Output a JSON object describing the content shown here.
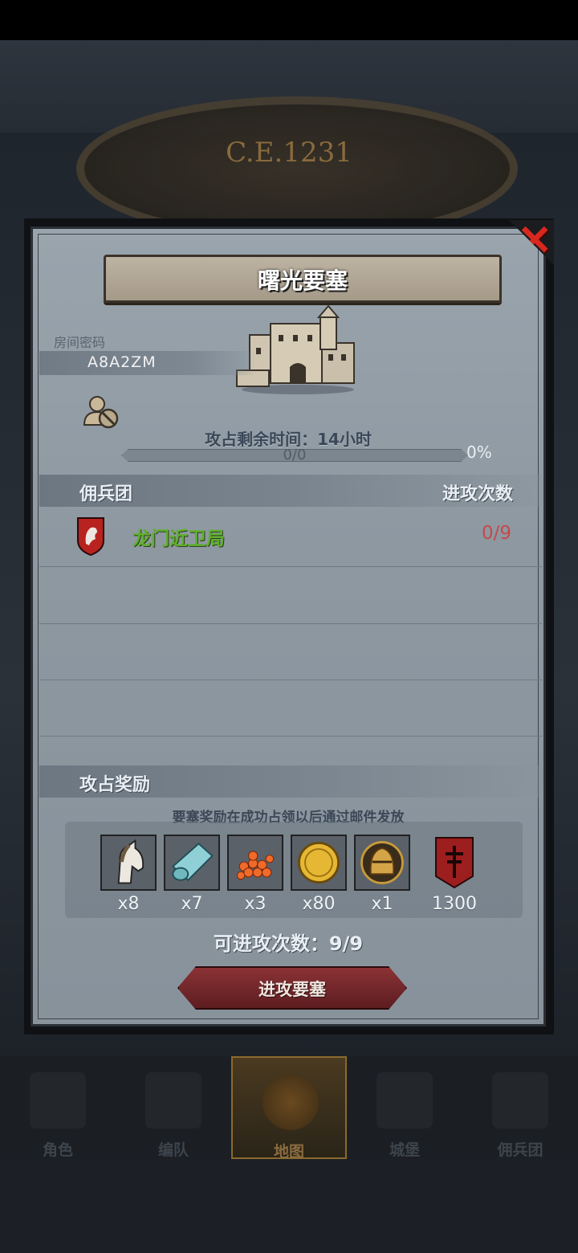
{
  "background": {
    "era_text": "C.E.1231"
  },
  "modal": {
    "title": "曙光要塞",
    "room_code_label": "房间密码",
    "room_code": "A8A2ZM",
    "time_remaining": "攻占剩余时间：14小时",
    "progress": {
      "value_text": "0/0",
      "percent_text": "0%",
      "fraction": 0
    },
    "mercenary_section": {
      "title": "佣兵团",
      "right_header": "进攻次数",
      "rows": [
        {
          "name": "龙门近卫局",
          "attacks": "0/9",
          "shield_color": "#b8231f"
        }
      ]
    },
    "reward_section": {
      "title": "攻占奖励",
      "notice": "要塞奖励在成功占领以后通过邮件发放",
      "items": [
        {
          "icon": "horse-icon",
          "qty": "x8"
        },
        {
          "icon": "cloth-roll-icon",
          "qty": "x7"
        },
        {
          "icon": "caviar-icon",
          "qty": "x3"
        },
        {
          "icon": "gold-coin-icon",
          "qty": "x80"
        },
        {
          "icon": "knight-helmet-icon",
          "qty": "x1"
        },
        {
          "icon": "guild-banner-icon",
          "qty": "1300"
        }
      ]
    },
    "attempts_text": "可进攻次数：9/9",
    "attack_button": "进攻要塞"
  },
  "nav": {
    "items": [
      {
        "label": "角色",
        "icon": "knight-icon"
      },
      {
        "label": "编队",
        "icon": "formation-icon"
      },
      {
        "label": "地图",
        "icon": "map-icon",
        "active": true
      },
      {
        "label": "城堡",
        "icon": "castle-icon"
      },
      {
        "label": "佣兵团",
        "icon": "mercenary-icon"
      }
    ]
  },
  "colors": {
    "guild_name": "#5fb02c",
    "attack_count": "#c24b4b",
    "close_x": "#d8281e",
    "button": "#7a2a2e"
  }
}
